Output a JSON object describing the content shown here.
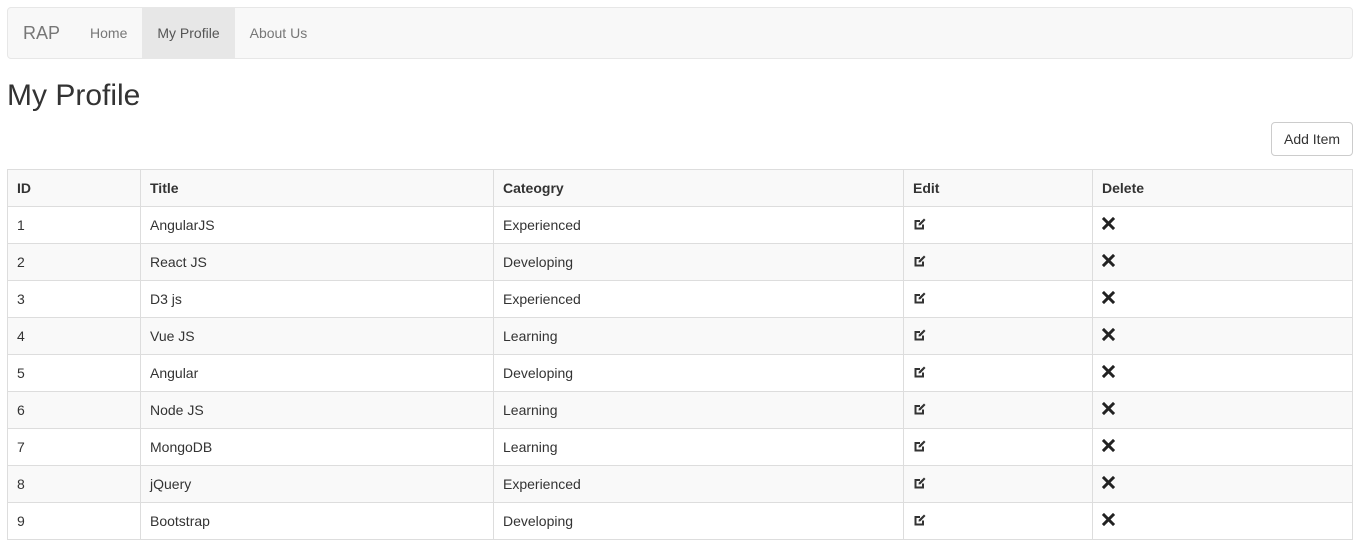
{
  "navbar": {
    "brand": "RAP",
    "items": [
      {
        "label": "Home",
        "active": false
      },
      {
        "label": "My Profile",
        "active": true
      },
      {
        "label": "About Us",
        "active": false
      }
    ]
  },
  "page": {
    "title": "My Profile",
    "add_button_label": "Add Item"
  },
  "table": {
    "columns": [
      "ID",
      "Title",
      "Cateogry",
      "Edit",
      "Delete"
    ],
    "rows": [
      {
        "id": "1",
        "title": "AngularJS",
        "category": "Experienced"
      },
      {
        "id": "2",
        "title": "React JS",
        "category": "Developing"
      },
      {
        "id": "3",
        "title": "D3 js",
        "category": "Experienced"
      },
      {
        "id": "4",
        "title": "Vue JS",
        "category": "Learning"
      },
      {
        "id": "5",
        "title": "Angular",
        "category": "Developing"
      },
      {
        "id": "6",
        "title": "Node JS",
        "category": "Learning"
      },
      {
        "id": "7",
        "title": "MongoDB",
        "category": "Learning"
      },
      {
        "id": "8",
        "title": "jQuery",
        "category": "Experienced"
      },
      {
        "id": "9",
        "title": "Bootstrap",
        "category": "Developing"
      }
    ],
    "edit_icon": "edit-icon",
    "delete_icon": "remove-icon"
  },
  "colors": {
    "navbar_bg": "#f8f8f8",
    "navbar_active_bg": "#e7e7e7",
    "border": "#dddddd",
    "stripe": "#f9f9f9"
  }
}
